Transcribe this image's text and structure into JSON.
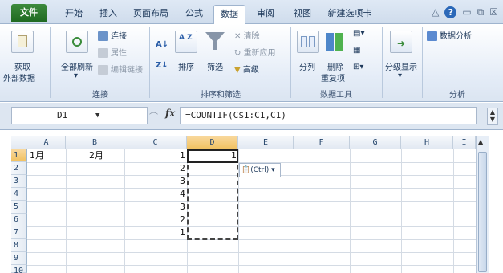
{
  "tabs": {
    "file": "文件",
    "home": "开始",
    "insert": "插入",
    "page_layout": "页面布局",
    "formulas": "公式",
    "data": "数据",
    "review": "审阅",
    "view": "视图",
    "new_tab": "新建选项卡"
  },
  "ribbon": {
    "get_external": "获取",
    "get_external2": "外部数据",
    "refresh_all": "全部刷新",
    "connections": "连接",
    "properties": "属性",
    "edit_links": "编辑链接",
    "group_connections": "连接",
    "sort": "排序",
    "filter": "筛选",
    "clear": "清除",
    "reapply": "重新应用",
    "advanced": "高级",
    "group_sort_filter": "排序和筛选",
    "text_to_columns": "分列",
    "remove_duplicates": "删除",
    "remove_duplicates2": "重复项",
    "group_data_tools": "数据工具",
    "outline": "分级显示",
    "data_analysis": "数据分析",
    "group_analysis": "分析"
  },
  "formula_bar": {
    "name_box": "D1",
    "fx_label": "fx",
    "formula": "=COUNTIF(C$1:C1,C1)"
  },
  "columns": [
    "A",
    "B",
    "C",
    "D",
    "E",
    "F",
    "G",
    "H",
    "I"
  ],
  "rows": [
    "1",
    "2",
    "3",
    "4",
    "5",
    "6",
    "7",
    "8",
    "9",
    "10"
  ],
  "cells": {
    "A1": "1月",
    "B1": "2月",
    "C1": "1",
    "C2": "2",
    "C3": "3",
    "C4": "4",
    "C5": "3",
    "C6": "2",
    "C7": "1",
    "D1": "1"
  },
  "paste_options_label": "(Ctrl)"
}
